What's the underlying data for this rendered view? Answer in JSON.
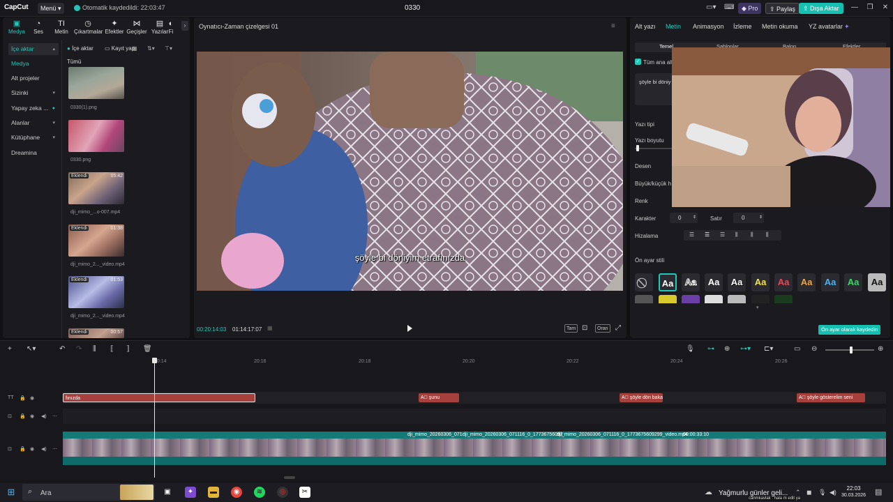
{
  "titlebar": {
    "logo": "CapCut",
    "menu_label": "Menü",
    "autosave": "Otomatik kaydedildi: 22:03:47",
    "project_name": "0330",
    "pro_label": "Pro",
    "share_label": "Paylaş",
    "export_label": "Dışa Aktar"
  },
  "toolbar": {
    "tabs": [
      "Medya",
      "Ses",
      "Metin",
      "Çıkartmalar",
      "Efektler",
      "Geçişler",
      "Yazılar",
      "Fi"
    ]
  },
  "media": {
    "categories": [
      "İçe aktar",
      "Medya",
      "Alt projeler",
      "Sizinki",
      "Yapay zeka ...",
      "Alanlar",
      "Kütüphane",
      "Dreamina"
    ],
    "import_label": "İçe aktar",
    "record_label": "Kayıt yap",
    "filter_all": "Tümü",
    "items": [
      {
        "name": "0330(1).png",
        "badge": "",
        "duration": ""
      },
      {
        "name": "0330.png",
        "badge": "",
        "duration": ""
      },
      {
        "name": "dji_mimo_...o-007.mp4",
        "badge": "Eklendi",
        "duration": "05:42"
      },
      {
        "name": "dji_mimo_2..._video.mp4",
        "badge": "Eklendi",
        "duration": "01:38"
      },
      {
        "name": "dji_mimo_2..._video.mp4",
        "badge": "Eklendi",
        "duration": "01:53"
      },
      {
        "name": "",
        "badge": "Eklendi",
        "duration": "00:57"
      }
    ]
  },
  "player": {
    "title": "Oynatıcı-Zaman çizelgesi 01",
    "subtitle": "şöyle bi döniyim etrafınızda",
    "current_time": "00:20:14:03",
    "total_time": "01:14:17:07",
    "full_label": "Tam",
    "ratio_label": "Oran"
  },
  "props": {
    "tabs": [
      "Alt yazı",
      "Metin",
      "Animasyon",
      "İzleme",
      "Metin okuma",
      "YZ avatarlar"
    ],
    "subtabs": [
      "Temel",
      "Şablonlar",
      "Balon",
      "Efektler"
    ],
    "all_lines": "Tüm ana alt",
    "text_preview": "şöyle bi döniy",
    "font_label": "Yazı tipi",
    "size_label": "Yazı boyutu",
    "pattern_label": "Desen",
    "case_label": "Büyük/küçük h",
    "color_label": "Renk",
    "char_label": "Karakter",
    "char_value": "0",
    "line_label": "Satır",
    "line_value": "0",
    "align_label": "Hizalama",
    "preset_label": "Ön ayar stili",
    "preset_sample": "Aa",
    "save_preset": "Ön ayar olarak kaydedin"
  },
  "timeline": {
    "ruler": [
      "20:14",
      "20:16",
      "20:18",
      "20:20",
      "20:22",
      "20:24",
      "20:26"
    ],
    "text_clips": [
      "fınızda",
      "şunu",
      "şöyle dön baka",
      "şöyle gösterelim seni"
    ],
    "video_labels": [
      "dji_mimo_20260306_071",
      "dji_mimo_20260306_071116_0_17736756092",
      "dji_mimo_20260306_071116_0_1773675609299_video.mp4",
      "00:00:33:10"
    ]
  },
  "taskbar": {
    "search_placeholder": "Ara",
    "weather": "Yağmurlu günler geli...",
    "notice": "canmkavlak : hala m edit ya",
    "time": "22:03",
    "date": "30.03.2026"
  },
  "colors": {
    "accent": "#20c9ba",
    "text_clip": "#a6403d",
    "video_clip": "#137a78"
  }
}
